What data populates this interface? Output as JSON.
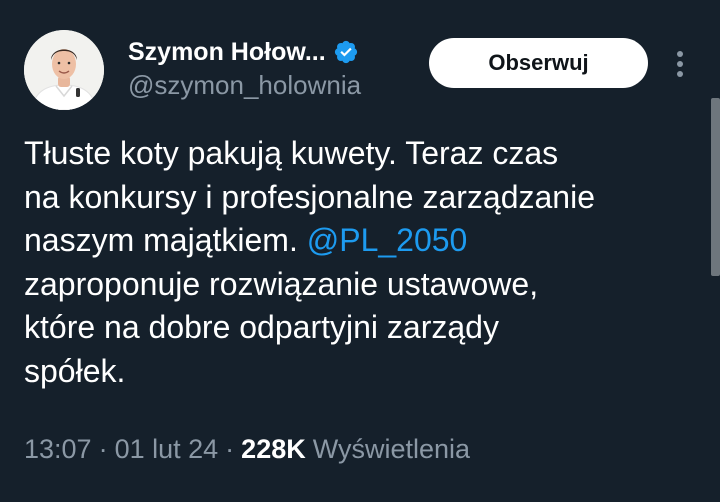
{
  "author": {
    "display_name": "Szymon Hołow...",
    "handle": "@szymon_holownia",
    "verified": true,
    "verified_color": "#1d9bf0"
  },
  "actions": {
    "follow_label": "Obserwuj",
    "more_icon": "more-vertical-icon"
  },
  "tweet": {
    "line1": "Tłuste koty pakują kuwety. Teraz czas",
    "line2": "na konkursy i profesjonalne zarządzanie",
    "line3_prefix": "naszym majątkiem.",
    "mention": "@PL_2050",
    "line4": "zaproponuje rozwiązanie ustawowe,",
    "line5": "które na dobre odpartyjni zarządy",
    "line6": "spółek."
  },
  "meta": {
    "time": "13:07",
    "separator": "·",
    "date": "01 lut 24",
    "views_count": "228K",
    "views_label": "Wyświetlenia"
  },
  "colors": {
    "background": "#15202b",
    "text": "#ffffff",
    "secondary_text": "#8b98a5",
    "link": "#1d9bf0"
  }
}
